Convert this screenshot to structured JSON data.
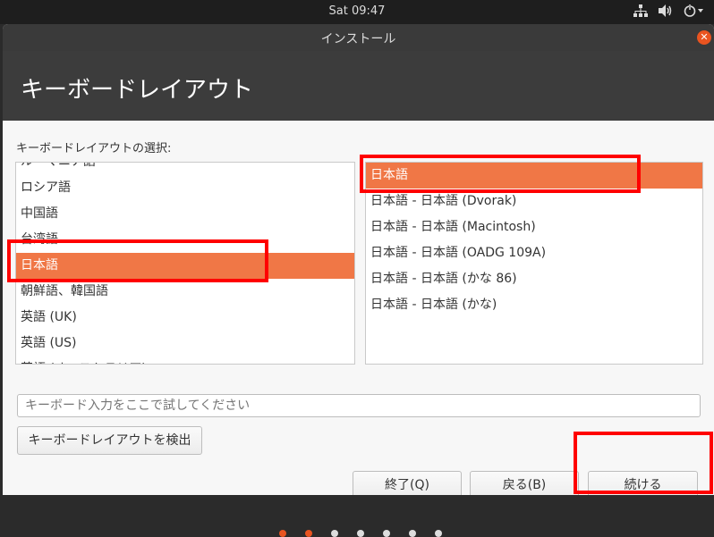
{
  "topbar": {
    "clock": "Sat 09:47",
    "network_icon": "network-icon",
    "volume_icon": "volume-icon",
    "power_icon": "power-icon"
  },
  "window": {
    "title": "インストール",
    "heading": "キーボードレイアウト"
  },
  "layout_section": {
    "label": "キーボードレイアウトの選択:"
  },
  "languages": [
    "ルーマニア語",
    "ロシア語",
    "中国語",
    "台湾語",
    "日本語",
    "朝鮮語、韓国語",
    "英語 (UK)",
    "英語 (US)",
    "英語 (オーストラリア)"
  ],
  "selected_language": "日本語",
  "variants": [
    "日本語",
    "日本語 - 日本語 (Dvorak)",
    "日本語 - 日本語 (Macintosh)",
    "日本語 - 日本語 (OADG 109A)",
    "日本語 - 日本語 (かな 86)",
    "日本語 - 日本語 (かな)"
  ],
  "selected_variant": "日本語",
  "test_input": {
    "placeholder": "キーボード入力をここで試してください",
    "value": ""
  },
  "buttons": {
    "detect": "キーボードレイアウトを検出",
    "quit": "終了(Q)",
    "back": "戻る(B)",
    "continue": "続ける"
  },
  "progress": {
    "total_steps": 7,
    "active_steps": [
      0,
      1
    ]
  },
  "colors": {
    "accent": "#e95420",
    "selection": "#f07746",
    "annotation": "#ff0000"
  }
}
